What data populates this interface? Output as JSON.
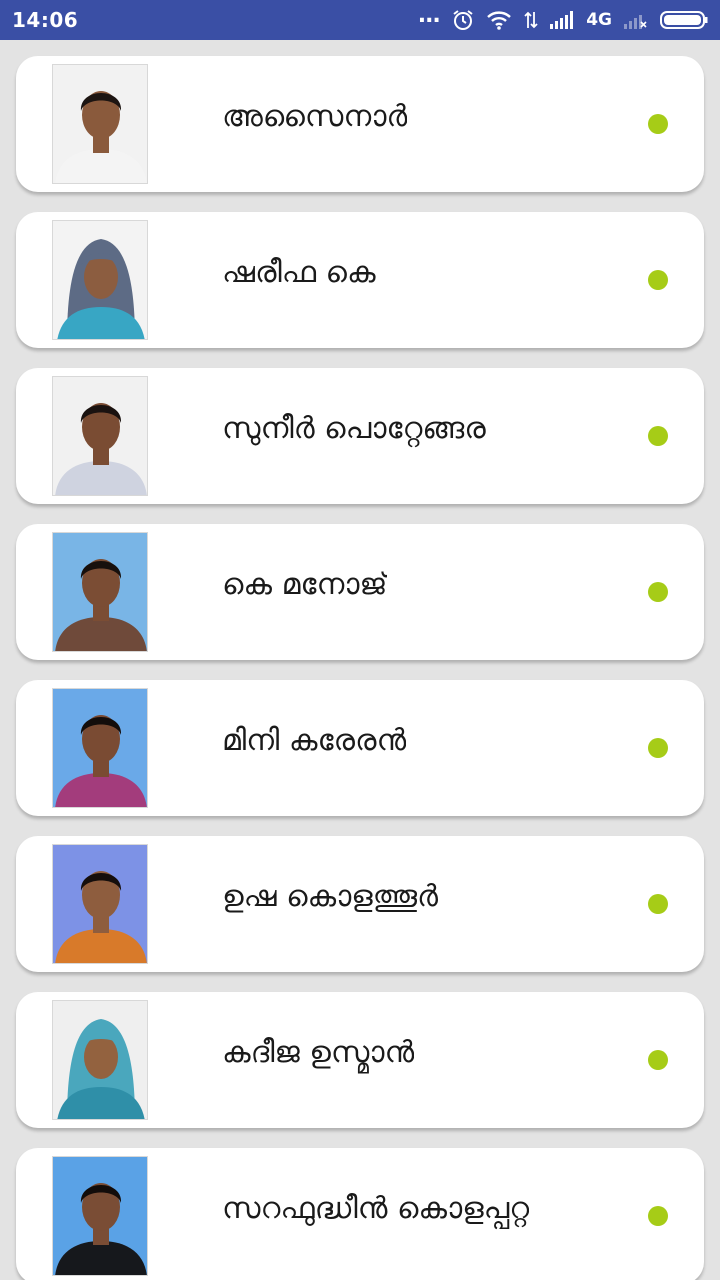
{
  "status_bar": {
    "time": "14:06",
    "network": "4G",
    "icons": [
      "more-dots-icon",
      "alarm-icon",
      "wifi-icon",
      "data-arrows-icon",
      "signal-icon",
      "signal-empty-icon",
      "battery-icon"
    ],
    "color": "#3a4fa5"
  },
  "members": [
    {
      "name": "അസൈനാർ",
      "photo_bg": "#f2f2f2",
      "shirt": "#f4f4f4",
      "skin": "#8a5a3c",
      "hair": "#1d1512",
      "hijab": "",
      "status_color": "#a6cc17"
    },
    {
      "name": "ഷരീഫ കെ",
      "photo_bg": "#f3f3f3",
      "shirt": "#38a6c4",
      "skin": "#8c5d40",
      "hair": "#1d1512",
      "hijab": "#5d6b85",
      "status_color": "#a6cc17"
    },
    {
      "name": "സുനീർ പൊറ്റേങ്ങര",
      "photo_bg": "#f1f1f1",
      "shirt": "#cfd3e0",
      "skin": "#7a4c33",
      "hair": "#1a1210",
      "hijab": "",
      "status_color": "#a6cc17"
    },
    {
      "name": "കെ മനോജ്",
      "photo_bg": "#79b5e6",
      "shirt": "#6f4a3a",
      "skin": "#7b4d34",
      "hair": "#17100d",
      "hijab": "",
      "status_color": "#a6cc17"
    },
    {
      "name": "മിനി കരേരൻ",
      "photo_bg": "#6aa9e8",
      "shirt": "#a33c7c",
      "skin": "#7a4b33",
      "hair": "#130d0b",
      "hijab": "",
      "status_color": "#a6cc17"
    },
    {
      "name": "ഉഷ കൊളത്തൂർ",
      "photo_bg": "#7d92e6",
      "shirt": "#d87a2a",
      "skin": "#8e5d3e",
      "hair": "#150e0c",
      "hijab": "",
      "status_color": "#a6cc17"
    },
    {
      "name": "കദീജ ഉസ്മാൻ",
      "photo_bg": "#efefef",
      "shirt": "#2f8fa8",
      "skin": "#93623f",
      "hair": "#1d1512",
      "hijab": "#4aa7bd",
      "status_color": "#a6cc17"
    },
    {
      "name": "സറഫുദ്ധീൻ കൊളപ്പറ്റ",
      "photo_bg": "#5aa2e6",
      "shirt": "#16181c",
      "skin": "#7a4d35",
      "hair": "#120c0a",
      "hijab": "",
      "status_color": "#a6cc17"
    }
  ]
}
